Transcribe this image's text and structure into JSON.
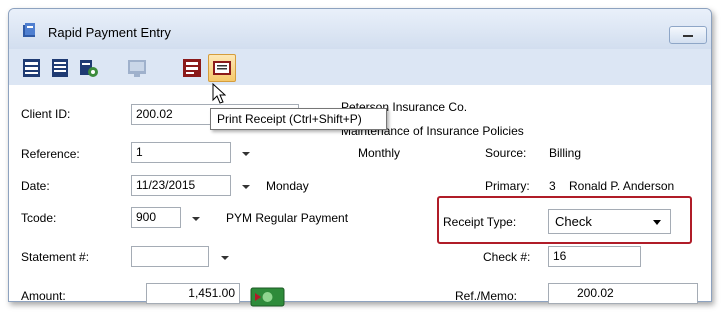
{
  "window": {
    "title": "Rapid Payment Entry"
  },
  "toolbar": {
    "buttons": [
      {
        "name": "list-view-icon"
      },
      {
        "name": "document-icon"
      },
      {
        "name": "batch-icon"
      },
      {
        "name": "network-icon"
      },
      {
        "name": "register-icon"
      },
      {
        "name": "print-receipt-icon"
      }
    ],
    "tooltip": "Print Receipt (Ctrl+Shift+P)"
  },
  "form": {
    "client_id": {
      "label": "Client ID:",
      "value": "200.02"
    },
    "client_name": "Peterson Insurance Co.",
    "client_desc": "Maintenance of Insurance Policies",
    "reference": {
      "label": "Reference:",
      "value": "1"
    },
    "frequency": "Monthly",
    "source": {
      "label": "Source:",
      "value": "Billing"
    },
    "date": {
      "label": "Date:",
      "value": "11/23/2015",
      "day": "Monday"
    },
    "primary": {
      "label": "Primary:",
      "number": "3",
      "name": "Ronald P. Anderson"
    },
    "tcode": {
      "label": "Tcode:",
      "value": "900",
      "description": "PYM Regular Payment"
    },
    "receipt_type": {
      "label": "Receipt Type:",
      "value": "Check"
    },
    "statement": {
      "label": "Statement #:",
      "value": ""
    },
    "check": {
      "label": "Check #:",
      "value": "16"
    },
    "amount": {
      "label": "Amount:",
      "value": "1,451.00"
    },
    "ref_memo": {
      "label": "Ref./Memo:",
      "value": "200.02"
    }
  },
  "colors": {
    "highlight": "#b01c28",
    "active_button": "#f6c96b"
  }
}
